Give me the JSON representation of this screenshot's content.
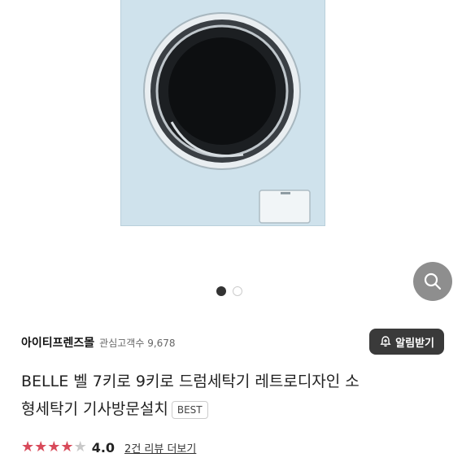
{
  "product_image": {
    "alt": "washing machine"
  },
  "carousel": {
    "total": 2,
    "active": 1
  },
  "seller": {
    "name": "아이티프렌즈몰",
    "watch_label": "관심고객수",
    "watch_count": "9,678"
  },
  "alert_button": {
    "label": "알림받기"
  },
  "product": {
    "title_line1": "BELLE 벨 7키로 9키로 드럼세탁기 레트로디자인 소",
    "title_line2": "형세탁기 기사방문설치",
    "badge": "BEST"
  },
  "rating": {
    "stars_filled": 4,
    "stars_total": 5,
    "score": "4.0",
    "review_link": "2건 리뷰 더보기"
  },
  "colors": {
    "star": "#d84a5a",
    "alert_bg": "#3a3a3a",
    "washer_body": "#cfe2ec"
  }
}
